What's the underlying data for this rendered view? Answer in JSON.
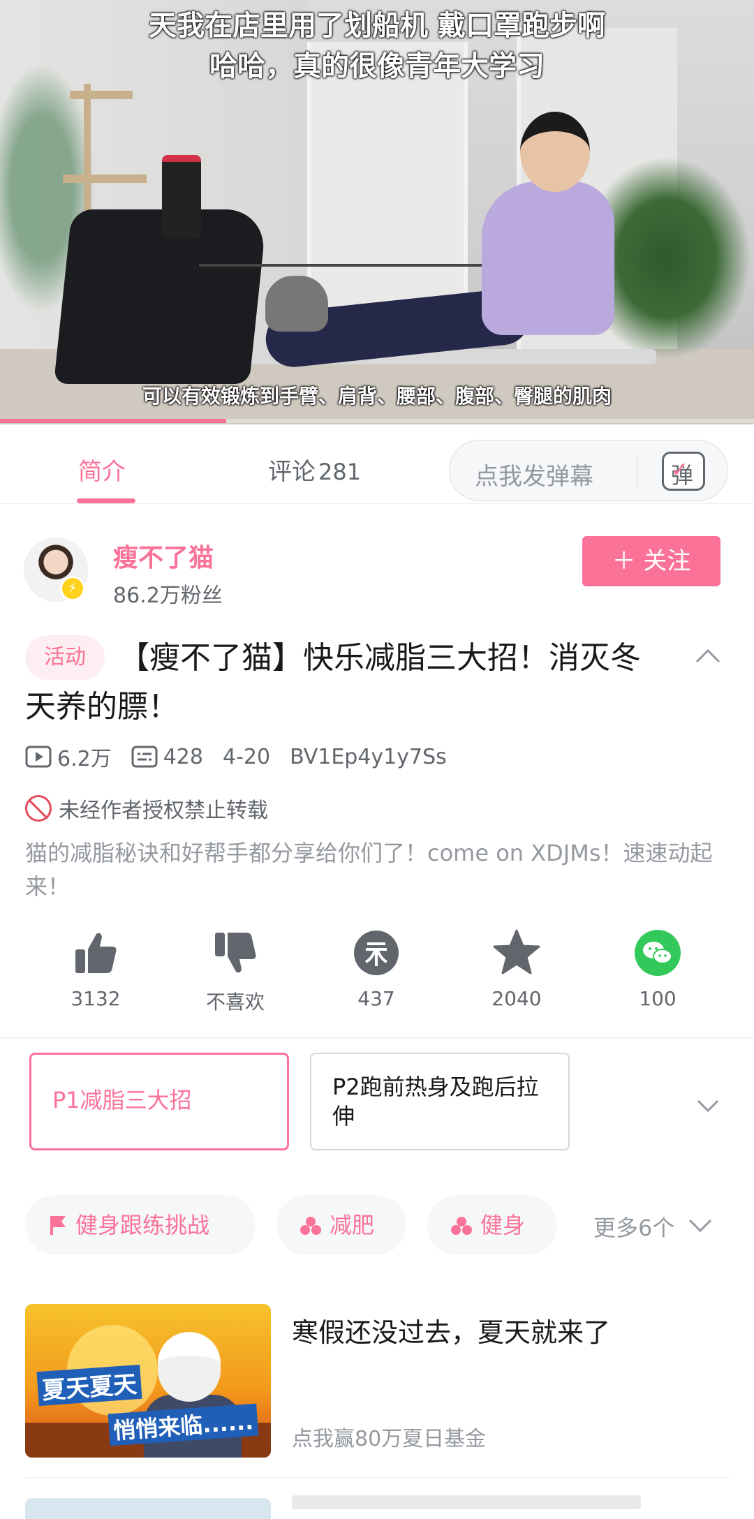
{
  "video": {
    "subtitle_top": "天我在店里用了划船机    戴口罩跑步啊",
    "subtitle_second": "哈哈，真的很像青年大学习",
    "subtitle_bottom": "可以有效锻炼到手臂、肩背、腰部、腹部、臀腿的肌肉",
    "progress_fraction": 0.3
  },
  "tabs": {
    "intro": "简介",
    "comments": "评论",
    "comment_count": "281",
    "danmaku_placeholder": "点我发弹幕",
    "danmaku_icon_label": "弹"
  },
  "author": {
    "name": "瘦不了猫",
    "fans": "86.2万粉丝",
    "follow_label": "＋ 关注",
    "badge_icon": "lightning-icon"
  },
  "video_info": {
    "tag": "活动",
    "title": "【瘦不了猫】快乐减脂三大招！消灭冬天养的膘！",
    "views": "6.2万",
    "danmaku_count": "428",
    "date": "4-20",
    "bvid": "BV1Ep4y1y7Ss",
    "copyright": "未经作者授权禁止转载",
    "description": "猫的减脂秘诀和好帮手都分享给你们了！come on XDJMs！速速动起来！"
  },
  "actions": [
    {
      "name": "like",
      "icon": "thumbs-up-icon",
      "count": "3132"
    },
    {
      "name": "dislike",
      "icon": "thumbs-down-icon",
      "count": "不喜欢"
    },
    {
      "name": "coin",
      "icon": "coin-icon",
      "count": "437"
    },
    {
      "name": "favorite",
      "icon": "star-icon",
      "count": "2040"
    },
    {
      "name": "share",
      "icon": "wechat-icon",
      "count": "100"
    }
  ],
  "parts": [
    {
      "label": "P1减脂三大招",
      "selected": true
    },
    {
      "label": "P2跑前热身及跑后拉伸",
      "selected": false
    }
  ],
  "tags": [
    {
      "label": "健身跟练挑战",
      "icon": "flag-icon"
    },
    {
      "label": "减肥",
      "icon": "cluster-icon"
    },
    {
      "label": "健身",
      "icon": "cluster-icon"
    }
  ],
  "more_tags": "更多6个",
  "recommend": {
    "title": "寒假还没过去，夏天就来了",
    "subtitle": "点我赢80万夏日基金",
    "thumb_text_1": "夏天夏天",
    "thumb_text_2": "悄悄来临......"
  },
  "colors": {
    "accent": "#fb7299",
    "text": "#18191c",
    "muted": "#9499a0"
  }
}
